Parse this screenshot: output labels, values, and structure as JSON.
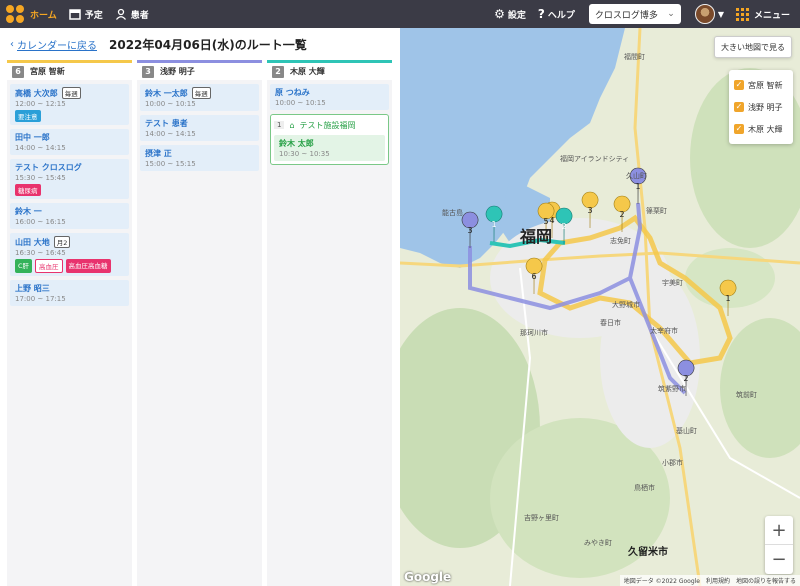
{
  "nav": {
    "home": "ホーム",
    "schedule": "予定",
    "patients": "患者",
    "settings": "設定",
    "help": "ヘルプ",
    "facility": "クロスログ博多",
    "menu": "メニュー"
  },
  "header": {
    "back": "カレンダーに戻る",
    "title": "2022年04月06日(水)のルート一覧"
  },
  "columns": [
    {
      "num": "6",
      "staff": "宮原 智新",
      "color": "#f5c84a",
      "visits": [
        {
          "name": "高橋 大次郎",
          "tag": "毎週",
          "time": "12:00 ~ 12:15",
          "badges": [
            {
              "text": "要注意",
              "style": "blue"
            }
          ]
        },
        {
          "name": "田中 一郎",
          "tag": "",
          "time": "14:00 ~ 14:15",
          "badges": []
        },
        {
          "name": "テスト クロスログ",
          "tag": "",
          "time": "15:30 ~ 15:45",
          "badges": [
            {
              "text": "糖尿病",
              "style": "pink"
            }
          ]
        },
        {
          "name": "鈴木 一",
          "tag": "",
          "time": "16:00 ~ 16:15",
          "badges": []
        },
        {
          "name": "山田 大地",
          "tag": "月2",
          "time": "16:30 ~ 16:45",
          "badges": [
            {
              "text": "C肝",
              "style": "green"
            },
            {
              "text": "高血圧",
              "style": "outline"
            },
            {
              "text": "高血圧高血糖",
              "style": "pink"
            }
          ]
        },
        {
          "name": "上野 昭三",
          "tag": "",
          "time": "17:00 ~ 17:15",
          "badges": []
        }
      ]
    },
    {
      "num": "3",
      "staff": "浅野 明子",
      "color": "#8c8fe0",
      "visits": [
        {
          "name": "鈴木 一太郎",
          "tag": "毎週",
          "time": "10:00 ~ 10:15",
          "badges": []
        },
        {
          "name": "テスト 患者",
          "tag": "",
          "time": "14:00 ~ 14:15",
          "badges": []
        },
        {
          "name": "摂津 正",
          "tag": "",
          "time": "15:00 ~ 15:15",
          "badges": []
        }
      ]
    },
    {
      "num": "2",
      "staff": "木原 大輝",
      "color": "#2ec4b6",
      "visits": [
        {
          "name": "原 つねみ",
          "tag": "",
          "time": "10:00 ~ 10:15",
          "badges": []
        }
      ],
      "facility": {
        "step": "1",
        "name": "テスト施設福岡",
        "patient": "鈴木 太郎",
        "time": "10:30 ~ 10:35"
      }
    }
  ],
  "map": {
    "enlarge": "大きい地図で見る",
    "legend": [
      "宮原 智新",
      "浅野 明子",
      "木原 大輝"
    ],
    "labels": {
      "fukuoka": "福岡",
      "kurume": "久留米市",
      "footer": "地図データ ©2022 Google　利用規約　地図の誤りを報告する",
      "google": "Google",
      "fukuma": "福間町",
      "nokonoshima": "能古島",
      "island_city": "福岡アイランドシティ",
      "kasuya": "久山町",
      "sasaguri": "篠栗町",
      "shime": "志免町",
      "onojo": "大野城市",
      "dazaifu": "太宰府市",
      "chikushino": "筑紫野市",
      "nakagawa": "那珂川市",
      "kiyama": "基山町",
      "ogori": "小郡市",
      "chikuzen": "筑前町",
      "tosu": "鳥栖市",
      "yoshinogari": "吉野ヶ里町",
      "miyaki": "みやき町",
      "kasuga": "春日市",
      "umi": "宇美町"
    },
    "zoom_in": "+",
    "zoom_out": "−"
  },
  "colors": {
    "yellow": "#f5c84a",
    "purple": "#8c8fe0",
    "teal": "#2ec4b6",
    "accent": "#f5a623"
  }
}
